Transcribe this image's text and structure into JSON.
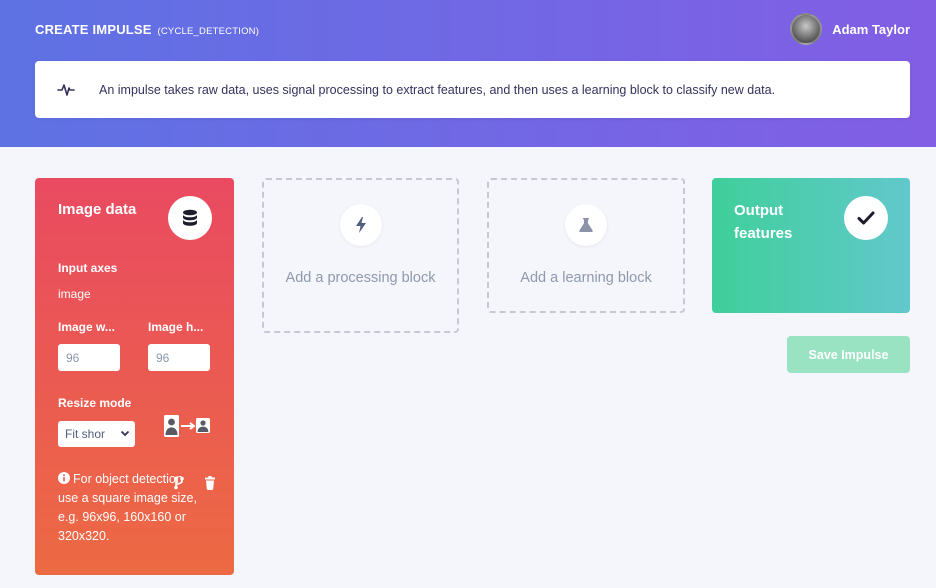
{
  "header": {
    "title": "CREATE IMPULSE",
    "subtitle": "(CYCLE_DETECTION)",
    "user_name": "Adam Taylor"
  },
  "info": {
    "icon": "pulse-icon",
    "text": "An impulse takes raw data, uses signal processing to extract features, and then uses a learning block to classify new data."
  },
  "input_block": {
    "title": "Image data",
    "icon": "database-icon",
    "input_axes_label": "Input axes",
    "input_axes_value": "image",
    "width_label": "Image w...",
    "width_value": "96",
    "height_label": "Image h...",
    "height_value": "96",
    "resize_mode_label": "Resize mode",
    "resize_mode_value": "Fit shor",
    "note": "For object detection use a square image size, e.g. 96x96, 160x160 or 320x320."
  },
  "processing_block": {
    "icon": "bolt-icon",
    "label": "Add a processing block"
  },
  "learning_block": {
    "icon": "flask-icon",
    "label": "Add a learning block"
  },
  "output_block": {
    "title": "Output features",
    "icon": "check-icon"
  },
  "save_label": "Save Impulse",
  "colors": {
    "header_start": "#5e72e4",
    "header_end": "#825ee4",
    "input_start": "#ea4a61",
    "input_end": "#ec6a43",
    "output_start": "#3fcf9a",
    "output_end": "#62c8cc",
    "save_button": "#99e3c3"
  }
}
